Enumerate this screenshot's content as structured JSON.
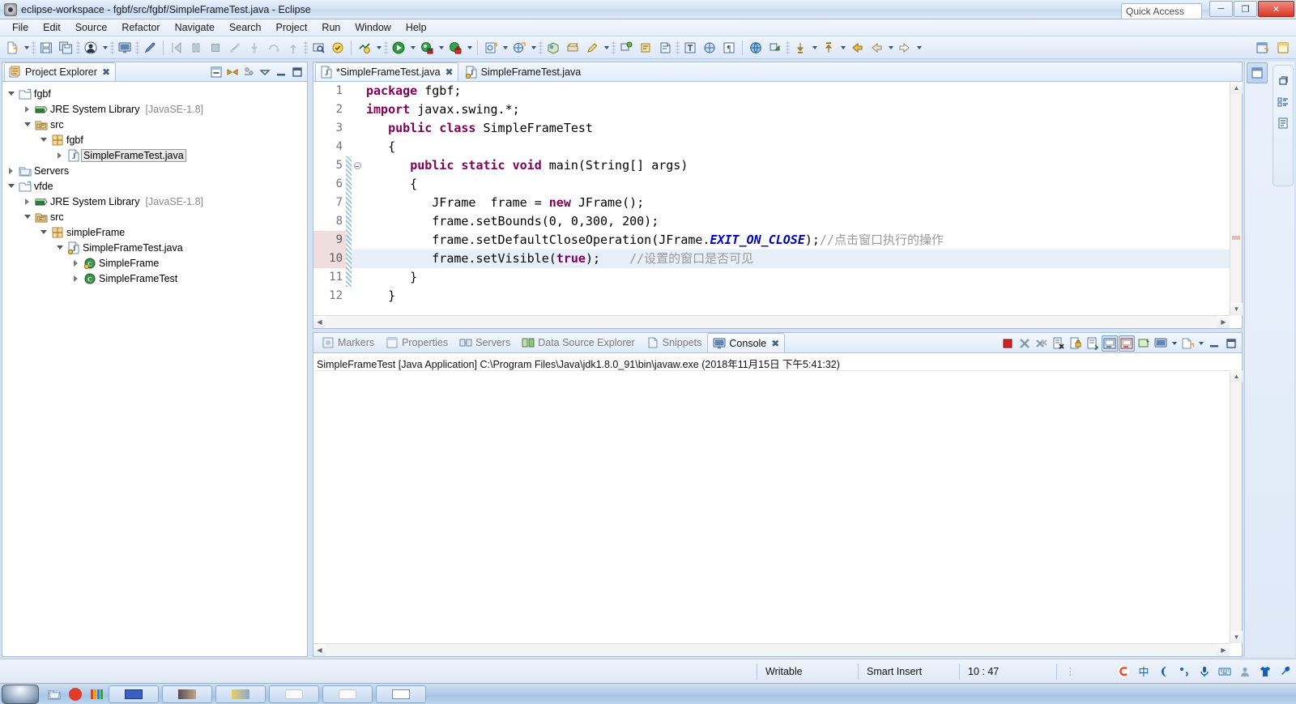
{
  "window": {
    "title": "eclipse-workspace - fgbf/src/fgbf/SimpleFrameTest.java - Eclipse",
    "minimize": "─",
    "maximize": "❐",
    "close": "✕"
  },
  "menubar": {
    "items": [
      "File",
      "Edit",
      "Source",
      "Refactor",
      "Navigate",
      "Search",
      "Project",
      "Run",
      "Window",
      "Help"
    ]
  },
  "toolbar": {
    "quick_access_placeholder": "Quick Access",
    "groups": [
      {
        "name": "new-group",
        "buttons": [
          {
            "name": "new-wizard-icon",
            "glyph": "new"
          },
          {
            "name": "new-dropdown-arrow",
            "glyph": "arrow"
          }
        ]
      },
      {
        "name": "save-group",
        "buttons": [
          {
            "name": "save-icon",
            "glyph": "save"
          },
          {
            "name": "save-all-icon",
            "glyph": "saveall"
          }
        ]
      },
      {
        "name": "user-group",
        "buttons": [
          {
            "name": "user-icon",
            "glyph": "user"
          },
          {
            "name": "user-dropdown-arrow",
            "glyph": "arrow"
          }
        ]
      },
      {
        "name": "console-group",
        "buttons": [
          {
            "name": "open-console-icon",
            "glyph": "console"
          }
        ]
      },
      {
        "name": "annotation-group",
        "buttons": [
          {
            "name": "toggle-mark-occurrences-icon",
            "glyph": "pen"
          }
        ]
      },
      {
        "name": "debug-step-group",
        "buttons": [
          {
            "name": "resume-icon",
            "glyph": "resume"
          },
          {
            "name": "suspend-icon",
            "glyph": "suspend"
          },
          {
            "name": "terminate-icon",
            "glyph": "terminate"
          },
          {
            "name": "disconnect-icon",
            "glyph": "disconnect"
          },
          {
            "name": "step-into-icon",
            "glyph": "stepinto"
          },
          {
            "name": "step-over-icon",
            "glyph": "stepover"
          },
          {
            "name": "step-return-icon",
            "glyph": "stepreturn"
          }
        ]
      },
      {
        "name": "search-group",
        "buttons": [
          {
            "name": "search-icon",
            "glyph": "search2"
          },
          {
            "name": "open-task-icon",
            "glyph": "task"
          }
        ]
      },
      {
        "name": "build-group",
        "buttons": [
          {
            "name": "build-all-icon",
            "glyph": "build"
          },
          {
            "name": "build-dropdown-arrow",
            "glyph": "arrow"
          }
        ]
      },
      {
        "name": "run-group",
        "buttons": [
          {
            "name": "run-icon",
            "glyph": "run"
          },
          {
            "name": "run-dropdown-arrow",
            "glyph": "arrow"
          },
          {
            "name": "debug-icon",
            "glyph": "debug"
          },
          {
            "name": "debug-dropdown-arrow",
            "glyph": "arrow"
          },
          {
            "name": "coverage-icon",
            "glyph": "coverage"
          },
          {
            "name": "coverage-dropdown-arrow",
            "glyph": "arrow"
          }
        ]
      },
      {
        "name": "newclass-group",
        "buttons": [
          {
            "name": "new-java-class-icon",
            "glyph": "newclass"
          },
          {
            "name": "new-class-dropdown-arrow",
            "glyph": "arrow"
          },
          {
            "name": "new-java-package-icon",
            "glyph": "newpkg"
          },
          {
            "name": "new-pkg-dropdown-arrow",
            "glyph": "arrow"
          }
        ]
      },
      {
        "name": "web-group",
        "buttons": [
          {
            "name": "open-web-browser-icon",
            "glyph": "web"
          },
          {
            "name": "new-server-icon",
            "glyph": "server"
          },
          {
            "name": "new-snippet-icon",
            "glyph": "pencil"
          },
          {
            "name": "web-dropdown-arrow",
            "glyph": "arrow"
          }
        ]
      },
      {
        "name": "annotate-group",
        "buttons": [
          {
            "name": "next-annotation-icon",
            "glyph": "annot"
          },
          {
            "name": "prev-annotation-icon",
            "glyph": "annot2"
          },
          {
            "name": "last-edit-location-icon",
            "glyph": "lastedit"
          }
        ]
      },
      {
        "name": "nav-group",
        "buttons": [
          {
            "name": "open-type-icon",
            "glyph": "opentype"
          },
          {
            "name": "show-whitespace-icon",
            "glyph": "whitespace"
          },
          {
            "name": "pilcrow-icon",
            "glyph": "pilcrow"
          }
        ]
      },
      {
        "name": "explore-group",
        "buttons": [
          {
            "name": "open-url-icon",
            "glyph": "globe"
          },
          {
            "name": "link-explorer-icon",
            "glyph": "link"
          }
        ]
      },
      {
        "name": "history-group",
        "buttons": [
          {
            "name": "next-edit-icon",
            "glyph": "downarrow"
          },
          {
            "name": "next-dropdown-arrow",
            "glyph": "arrow"
          },
          {
            "name": "prev-edit-icon",
            "glyph": "uparrow"
          },
          {
            "name": "prev-dropdown-arrow",
            "glyph": "arrow"
          },
          {
            "name": "back-icon",
            "glyph": "back"
          },
          {
            "name": "back2-icon",
            "glyph": "back2"
          },
          {
            "name": "back-dropdown-arrow",
            "glyph": "arrow"
          },
          {
            "name": "forward-icon",
            "glyph": "forward"
          },
          {
            "name": "forward-dropdown-arrow",
            "glyph": "arrow"
          }
        ]
      }
    ],
    "right_buttons": [
      {
        "name": "open-perspective-icon",
        "glyph": "perspective"
      },
      {
        "name": "java-ee-perspective-icon",
        "glyph": "javaee"
      }
    ]
  },
  "explorer": {
    "tab_label": "Project Explorer",
    "tab_close": "✖",
    "actions": [
      {
        "name": "collapse-all-icon",
        "glyph": "collapse"
      },
      {
        "name": "link-with-editor-icon",
        "glyph": "linkeditor"
      },
      {
        "name": "view-menu-filter-icon",
        "glyph": "filter"
      },
      {
        "name": "view-menu-icon",
        "glyph": "viewmenu"
      },
      {
        "name": "minimize-view-icon",
        "glyph": "minimize"
      },
      {
        "name": "maximize-view-icon",
        "glyph": "maximize"
      }
    ],
    "tree": [
      {
        "label": "fgbf",
        "indent": 0,
        "twist": "open",
        "icon": "project",
        "dim": "",
        "selected": false
      },
      {
        "label": "JRE System Library",
        "suffix": "[JavaSE-1.8]",
        "indent": 1,
        "twist": "closed",
        "icon": "library",
        "selected": false
      },
      {
        "label": "src",
        "indent": 1,
        "twist": "open",
        "icon": "sourcefolder",
        "selected": false
      },
      {
        "label": "fgbf",
        "indent": 2,
        "twist": "open",
        "icon": "package",
        "selected": false
      },
      {
        "label": "SimpleFrameTest.java",
        "indent": 3,
        "twist": "closed",
        "icon": "javafile",
        "selected": true
      },
      {
        "label": "Servers",
        "indent": 0,
        "twist": "closed",
        "icon": "folder",
        "selected": false
      },
      {
        "label": "vfde",
        "indent": 0,
        "twist": "open",
        "icon": "project",
        "selected": false
      },
      {
        "label": "JRE System Library",
        "suffix": "[JavaSE-1.8]",
        "indent": 1,
        "twist": "closed",
        "icon": "library",
        "selected": false
      },
      {
        "label": "src",
        "indent": 1,
        "twist": "open",
        "icon": "sourcefolder",
        "selected": false
      },
      {
        "label": "simpleFrame",
        "indent": 2,
        "twist": "open",
        "icon": "package",
        "selected": false
      },
      {
        "label": "SimpleFrameTest.java",
        "indent": 3,
        "twist": "open",
        "icon": "javafile2",
        "selected": false
      },
      {
        "label": "SimpleFrame",
        "indent": 4,
        "twist": "closed",
        "icon": "class",
        "selected": false
      },
      {
        "label": "SimpleFrameTest",
        "indent": 4,
        "twist": "closed",
        "icon": "class2",
        "selected": false
      }
    ]
  },
  "editor": {
    "tabs": [
      {
        "label": "*SimpleFrameTest.java",
        "active": true,
        "dirty": true,
        "close": "✖",
        "icon": "javafile"
      },
      {
        "label": "SimpleFrameTest.java",
        "active": false,
        "dirty": false,
        "close": "",
        "icon": "javafile2"
      }
    ],
    "lines": [
      {
        "num": "1",
        "changed": false,
        "fold": false,
        "gutter_hl": false,
        "current": false,
        "tokens": [
          {
            "t": "package",
            "c": "kw"
          },
          {
            "t": " fgbf;",
            "c": "plain"
          }
        ]
      },
      {
        "num": "2",
        "changed": false,
        "fold": false,
        "gutter_hl": false,
        "current": false,
        "tokens": [
          {
            "t": "import",
            "c": "kw"
          },
          {
            "t": " javax.swing.*;",
            "c": "plain"
          }
        ]
      },
      {
        "num": "3",
        "changed": false,
        "fold": false,
        "gutter_hl": false,
        "current": false,
        "tokens": [
          {
            "t": "   ",
            "c": "plain"
          },
          {
            "t": "public class",
            "c": "kw"
          },
          {
            "t": " SimpleFrameTest",
            "c": "plain"
          }
        ]
      },
      {
        "num": "4",
        "changed": false,
        "fold": false,
        "gutter_hl": false,
        "current": false,
        "tokens": [
          {
            "t": "   {",
            "c": "plain"
          }
        ]
      },
      {
        "num": "5",
        "changed": true,
        "fold": true,
        "gutter_hl": false,
        "current": false,
        "tokens": [
          {
            "t": "      ",
            "c": "plain"
          },
          {
            "t": "public static void",
            "c": "kw"
          },
          {
            "t": " main(String[] args)",
            "c": "plain"
          }
        ]
      },
      {
        "num": "6",
        "changed": true,
        "fold": false,
        "gutter_hl": false,
        "current": false,
        "tokens": [
          {
            "t": "      {",
            "c": "plain"
          }
        ]
      },
      {
        "num": "7",
        "changed": true,
        "fold": false,
        "gutter_hl": false,
        "current": false,
        "tokens": [
          {
            "t": "         JFrame  frame = ",
            "c": "plain"
          },
          {
            "t": "new",
            "c": "kw"
          },
          {
            "t": " JFrame();",
            "c": "plain"
          }
        ]
      },
      {
        "num": "8",
        "changed": true,
        "fold": false,
        "gutter_hl": false,
        "current": false,
        "tokens": [
          {
            "t": "         frame.setBounds(0, 0,300, 200);",
            "c": "plain"
          }
        ]
      },
      {
        "num": "9",
        "changed": true,
        "fold": false,
        "gutter_hl": true,
        "current": false,
        "tokens": [
          {
            "t": "         frame.setDefaultCloseOperation(JFrame.",
            "c": "plain"
          },
          {
            "t": "EXIT_ON_CLOSE",
            "c": "stat"
          },
          {
            "t": ");",
            "c": "plain"
          },
          {
            "t": "//点击窗口执行的操作",
            "c": "cmt2"
          }
        ]
      },
      {
        "num": "10",
        "changed": true,
        "fold": false,
        "gutter_hl": true,
        "current": true,
        "tokens": [
          {
            "t": "         frame.setVisible(",
            "c": "plain"
          },
          {
            "t": "true",
            "c": "kw"
          },
          {
            "t": ");    ",
            "c": "plain"
          },
          {
            "t": "//设置的窗口是否可见",
            "c": "cmt2"
          }
        ]
      },
      {
        "num": "11",
        "changed": true,
        "fold": false,
        "gutter_hl": false,
        "current": false,
        "tokens": [
          {
            "t": "      }",
            "c": "plain"
          }
        ]
      },
      {
        "num": "12",
        "changed": false,
        "fold": false,
        "gutter_hl": false,
        "current": false,
        "tokens": [
          {
            "t": "   }",
            "c": "plain"
          }
        ]
      }
    ]
  },
  "console": {
    "tabs": [
      {
        "label": "Markers",
        "active": false,
        "icon": "markers"
      },
      {
        "label": "Properties",
        "active": false,
        "icon": "properties"
      },
      {
        "label": "Servers",
        "active": false,
        "icon": "servers"
      },
      {
        "label": "Data Source Explorer",
        "active": false,
        "icon": "datasource"
      },
      {
        "label": "Snippets",
        "active": false,
        "icon": "snippets"
      },
      {
        "label": "Console",
        "active": true,
        "icon": "console",
        "close": "✖"
      }
    ],
    "actions": [
      {
        "name": "terminate-icon",
        "glyph": "stop",
        "pressed": false
      },
      {
        "name": "remove-launch-icon",
        "glyph": "removex",
        "pressed": false
      },
      {
        "name": "remove-all-launches-icon",
        "glyph": "removeallx",
        "pressed": false
      },
      {
        "name": "clear-console-icon",
        "glyph": "clear",
        "pressed": false
      },
      {
        "name": "scroll-lock-icon",
        "glyph": "scrolllock",
        "pressed": false
      },
      {
        "name": "word-wrap-icon",
        "glyph": "wordwrap",
        "pressed": false
      },
      {
        "name": "show-console-on-output-icon",
        "glyph": "showout",
        "pressed": true
      },
      {
        "name": "show-console-on-error-icon",
        "glyph": "showerr",
        "pressed": true
      },
      {
        "name": "pin-console-icon",
        "glyph": "pin",
        "pressed": false
      },
      {
        "name": "display-selected-console-icon",
        "glyph": "display",
        "pressed": false
      },
      {
        "name": "display-dropdown-arrow",
        "glyph": "arrow",
        "pressed": false
      },
      {
        "name": "open-console-icon",
        "glyph": "newconsole",
        "pressed": false
      },
      {
        "name": "open-console-dropdown-arrow",
        "glyph": "arrow",
        "pressed": false
      },
      {
        "name": "minimize-console-icon",
        "glyph": "minimize",
        "pressed": false
      },
      {
        "name": "maximize-console-icon",
        "glyph": "maximize",
        "pressed": false
      }
    ],
    "output_line": "SimpleFrameTest [Java Application] C:\\Program Files\\Java\\jdk1.8.0_91\\bin\\javaw.exe (2018年11月15日 下午5:41:32)"
  },
  "right_strip": {
    "perspective_icon": "java-ee-perspective-icon",
    "fast_view_icons": [
      {
        "name": "restore-icon",
        "glyph": "restore"
      },
      {
        "name": "outline-view-icon",
        "glyph": "outline"
      },
      {
        "name": "task-list-icon",
        "glyph": "tasklist"
      }
    ]
  },
  "statusbar": {
    "writable": "Writable",
    "insert_mode": "Smart Insert",
    "cursor_position": "10 : 47",
    "tray": [
      {
        "name": "sogou-input-icon",
        "glyph": "sogou"
      },
      {
        "name": "chinese-mode-icon",
        "glyph": "zhong"
      },
      {
        "name": "moon-icon",
        "glyph": "moon"
      },
      {
        "name": "punctuation-icon",
        "glyph": "punct"
      },
      {
        "name": "voice-input-icon",
        "glyph": "mic"
      },
      {
        "name": "soft-keyboard-icon",
        "glyph": "keyboard"
      },
      {
        "name": "user-center-icon",
        "glyph": "person"
      },
      {
        "name": "skin-icon",
        "glyph": "shirt"
      },
      {
        "name": "toolbox-icon",
        "glyph": "wrench"
      }
    ]
  },
  "taskbar": {
    "items": [
      {
        "name": "start-button",
        "glyph": "orb"
      },
      {
        "name": "quick-launch-explorer",
        "glyph": "folder"
      },
      {
        "name": "quick-launch-media",
        "glyph": "red"
      },
      {
        "name": "quick-launch-colors",
        "glyph": "bars"
      },
      {
        "name": "task-window-1",
        "glyph": "blue"
      },
      {
        "name": "task-window-2",
        "glyph": "dark"
      },
      {
        "name": "task-window-3",
        "glyph": "yellow"
      },
      {
        "name": "task-window-4",
        "glyph": "white"
      },
      {
        "name": "task-window-5",
        "glyph": "white"
      },
      {
        "name": "task-window-6",
        "glyph": "chart"
      }
    ]
  }
}
